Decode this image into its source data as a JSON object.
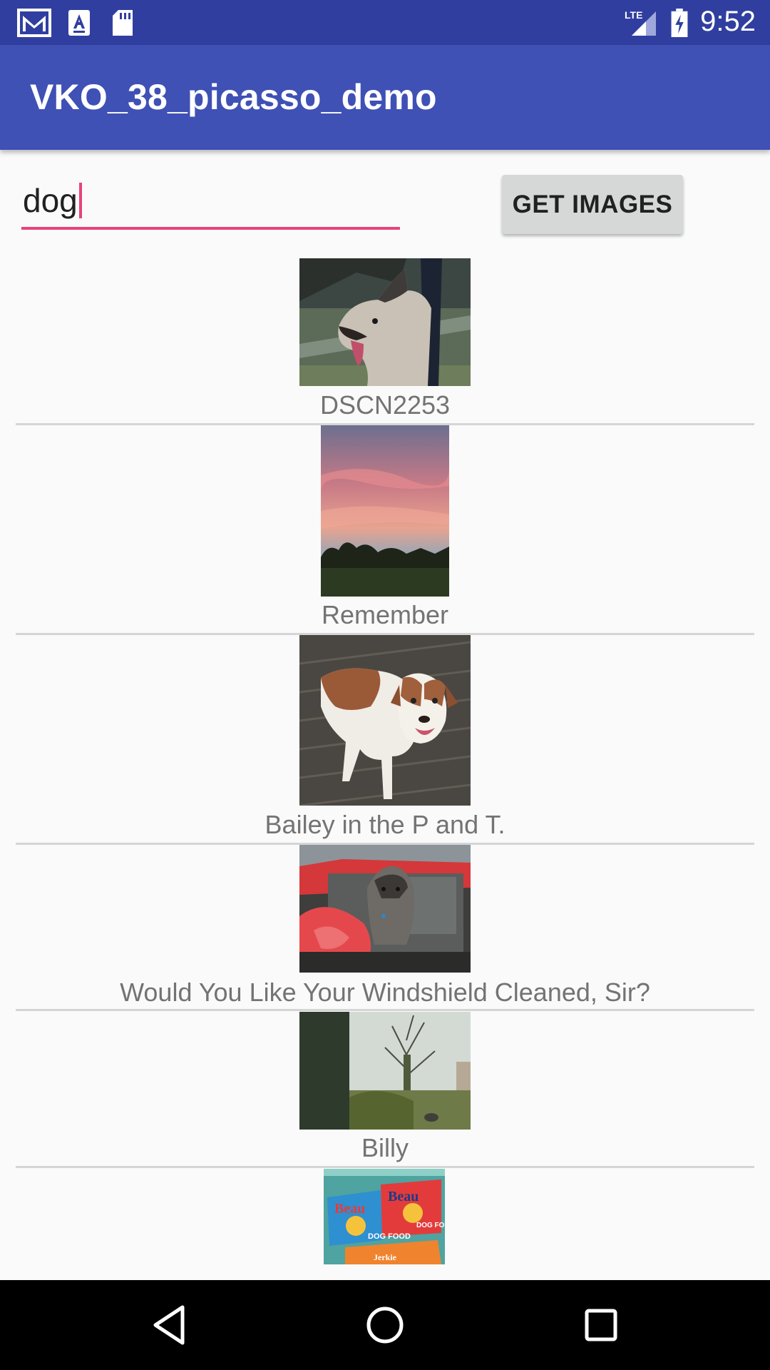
{
  "status_bar": {
    "time": "9:52",
    "network_label": "LTE",
    "icons": [
      "gmail-icon",
      "text-icon",
      "sd-card-icon",
      "signal-icon",
      "battery-charging-icon"
    ]
  },
  "app_bar": {
    "title": "VKO_38_picasso_demo"
  },
  "search": {
    "value": "dog",
    "button_label": "GET IMAGES"
  },
  "images": [
    {
      "caption": "DSCN2253",
      "subject": "husky-dog-photo"
    },
    {
      "caption": "Remember",
      "subject": "sunset-sky-photo"
    },
    {
      "caption": "Bailey in the P and T.",
      "subject": "brown-white-dog-photo"
    },
    {
      "caption": "Would You Like Your Windshield Cleaned, Sir?",
      "subject": "dog-in-car-photo"
    },
    {
      "caption": "Billy",
      "subject": "trees-field-photo"
    },
    {
      "caption": "",
      "subject": "dog-food-packaging-photo"
    }
  ],
  "nav_bar": {
    "icons": [
      "back-icon",
      "home-icon",
      "recents-icon"
    ]
  },
  "colors": {
    "status_bar": "#303F9F",
    "app_bar": "#3F51B5",
    "accent": "#E8437A",
    "button": "#D6D7D7",
    "background": "#FAFAFA"
  }
}
